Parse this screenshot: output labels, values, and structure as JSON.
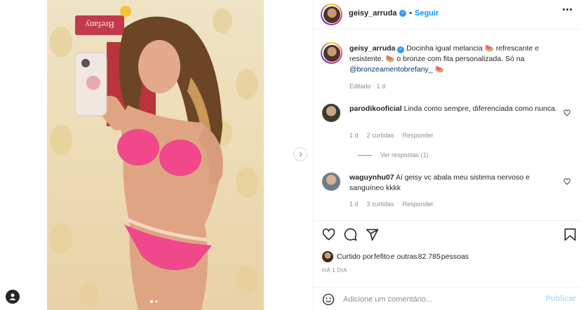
{
  "post": {
    "author": "geisy_arruda",
    "follow_label": "Seguir",
    "separator": "•",
    "verified_glyph": "✓"
  },
  "caption": {
    "user": "geisy_arruda",
    "text": "Docinha igual melancia 🍉 refrescante e resistente. 🍉 o bronze com fita personalizada. Só na ",
    "mention": "@bronzeamentobrefany_",
    "tail": " 🍉",
    "meta": "Editado · 1 d"
  },
  "comments": [
    {
      "user": "parodikooficial",
      "text": "Linda como sempre, diferenciada como nunca.",
      "time": "1 d",
      "likes": "2 curtidas",
      "reply": "Responder",
      "view_replies": "Ver respostas (1)"
    },
    {
      "user": "waguynhu07",
      "text": "Aí geisy vc abala meu sistema nervoso e sanguíneo kkkk",
      "time": "1 d",
      "likes": "3 curtidas",
      "reply": "Responder"
    }
  ],
  "likes_text": {
    "prefix": "Curtido por ",
    "user": "fefito",
    "suffix": " e outras ",
    "count": "82.785",
    "unit": " pessoas"
  },
  "time_ago": "HÁ 1 DIA",
  "comment_box": {
    "placeholder": "Adicione um comentário...",
    "publish": "Publicar"
  },
  "media": {
    "sign_text": "Brefany",
    "total_slides": 2,
    "active_slide": 1
  },
  "colors": {
    "accent": "#0095f6",
    "verified": "#3897f0",
    "publish_disabled": "#b2dffc",
    "bikini": "#f0488a"
  },
  "icons": [
    "like-icon",
    "comment-icon",
    "share-icon",
    "save-icon",
    "emoji-icon",
    "more-options-icon",
    "next-arrow-icon",
    "profile-icon",
    "small-heart-icon"
  ]
}
